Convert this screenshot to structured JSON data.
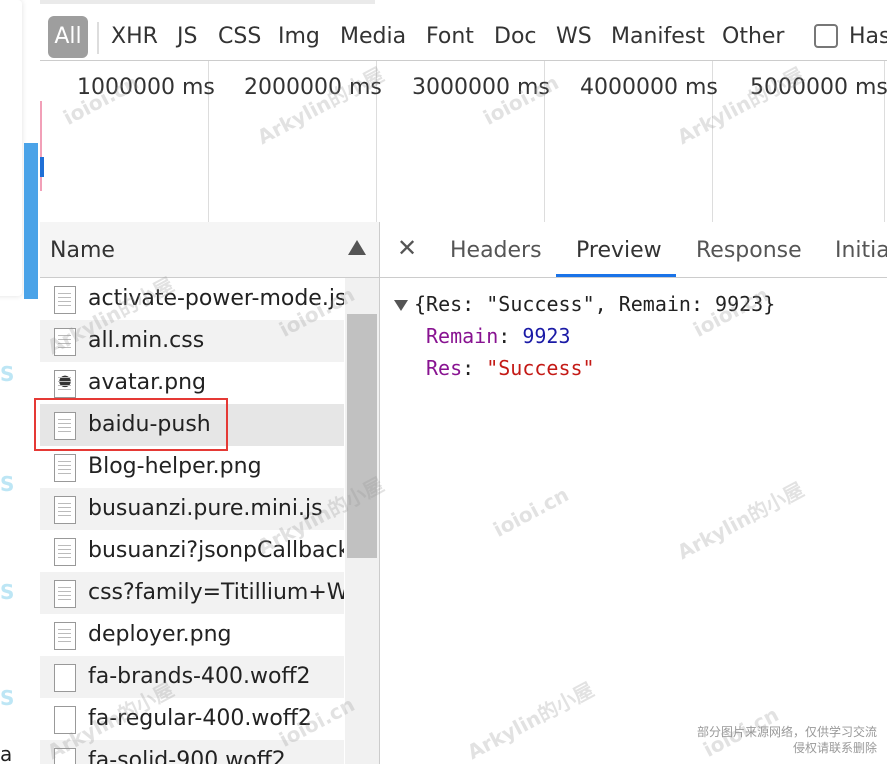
{
  "filter_bar": {
    "items": [
      "All",
      "XHR",
      "JS",
      "CSS",
      "Img",
      "Media",
      "Font",
      "Doc",
      "WS",
      "Manifest",
      "Other"
    ],
    "has_label": "Has"
  },
  "overview": {
    "ticks": [
      "1000000 ms",
      "2000000 ms",
      "3000000 ms",
      "4000000 ms",
      "5000000 ms"
    ]
  },
  "name_panel": {
    "header": "Name",
    "files": [
      {
        "name": "activate-power-mode.js",
        "icon": "file-script-icon"
      },
      {
        "name": "all.min.css",
        "icon": "file-stylesheet-icon"
      },
      {
        "name": "avatar.png",
        "icon": "image-avatar-icon"
      },
      {
        "name": "baidu-push",
        "icon": "file-document-icon",
        "selected": true
      },
      {
        "name": "Blog-helper.png",
        "icon": "image-file-icon"
      },
      {
        "name": "busuanzi.pure.mini.js",
        "icon": "file-script-icon"
      },
      {
        "name": "busuanzi?jsonpCallback.",
        "icon": "file-script-icon"
      },
      {
        "name": "css?family=Titillium+We",
        "icon": "file-stylesheet-icon"
      },
      {
        "name": "deployer.png",
        "icon": "image-file-icon"
      },
      {
        "name": "fa-brands-400.woff2",
        "icon": "font-file-icon"
      },
      {
        "name": "fa-regular-400.woff2",
        "icon": "font-file-icon"
      },
      {
        "name": "fa-solid-900.woff2",
        "icon": "font-file-icon"
      }
    ]
  },
  "details": {
    "tabs": [
      "Headers",
      "Preview",
      "Response",
      "Initia"
    ],
    "active_tab": "Preview",
    "preview": {
      "summary": "{Res: \"Success\", Remain: 9923}",
      "fields": [
        {
          "key": "Remain",
          "value": "9923",
          "type": "number"
        },
        {
          "key": "Res",
          "value": "\"Success\"",
          "type": "string"
        }
      ]
    }
  },
  "watermarks": {
    "site": "ioioi.cn",
    "author": "Arkylin的小屋",
    "notice_line1": "部分图片来源网络，仅供学习交流",
    "notice_line2": "侵权请联系删除"
  },
  "page_left": {
    "glyph": "S",
    "letter": "a"
  },
  "colors": {
    "accent": "#1a73e8",
    "highlight": "#e53935",
    "key": "#881391",
    "number": "#1a1aa6",
    "string": "#c41a16"
  }
}
